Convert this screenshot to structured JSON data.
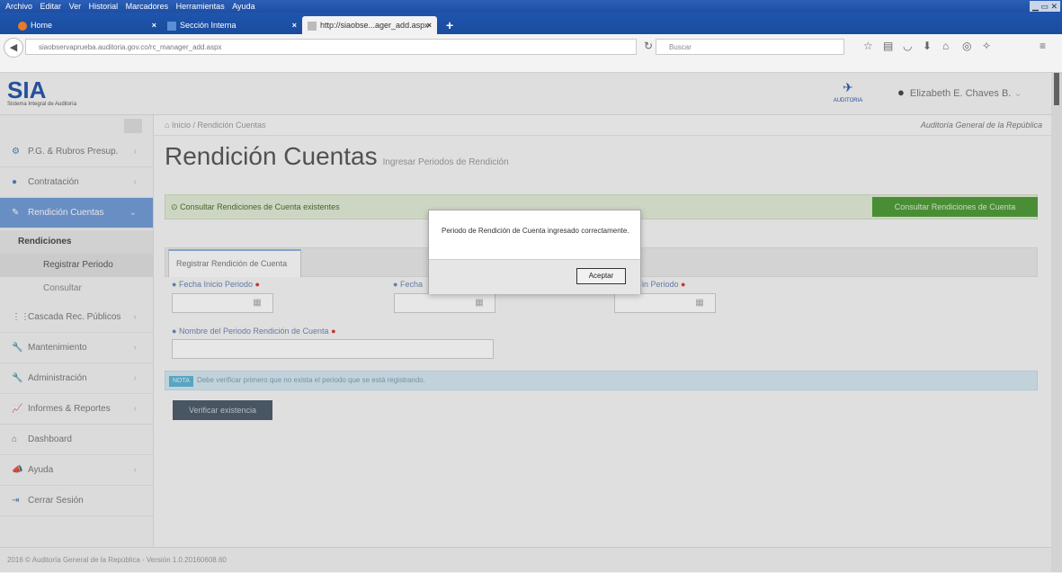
{
  "browser": {
    "menu": [
      "Archivo",
      "Editar",
      "Ver",
      "Historial",
      "Marcadores",
      "Herramientas",
      "Ayuda"
    ],
    "tabs": [
      {
        "label": "Home"
      },
      {
        "label": "Sección Interna"
      },
      {
        "label": "http://siaobse...ager_add.aspx"
      }
    ],
    "url": "siaobservaprueba.auditoria.gov.co/rc_manager_add.aspx",
    "search_placeholder": "Buscar"
  },
  "header": {
    "logo_text": "SIA",
    "logo_sub": "Sistema Integral de Auditoría",
    "auditoria_label": "AUDITORIA",
    "user_name": "Elizabeth E. Chaves B."
  },
  "sidebar": {
    "items": [
      {
        "label": "P.G. & Rubros Presup.",
        "icon": "sliders-icon"
      },
      {
        "label": "Contratación",
        "icon": "circle-icon"
      },
      {
        "label": "Rendición Cuentas",
        "icon": "edit-icon"
      },
      {
        "label": "Cascada Rec. Públicos",
        "icon": "grid-icon"
      },
      {
        "label": "Mantenimiento",
        "icon": "wrench-icon"
      },
      {
        "label": "Administración",
        "icon": "wrench-icon"
      },
      {
        "label": "Informes & Reportes",
        "icon": "chart-icon"
      },
      {
        "label": "Dashboard",
        "icon": "home-icon"
      },
      {
        "label": "Ayuda",
        "icon": "bullhorn-icon"
      },
      {
        "label": "Cerrar Sesión",
        "icon": "logout-icon"
      }
    ],
    "sub_header": "Rendiciones",
    "sub_items": [
      "Registrar Periodo",
      "Consultar"
    ]
  },
  "breadcrumb": {
    "home": "Inicio",
    "current": "Rendición Cuentas",
    "org": "Auditoría General de la República"
  },
  "page": {
    "title": "Rendición Cuentas",
    "subtitle": "Ingresar Periodos de Rendición",
    "alert": "Consultar Rendiciones de Cuenta existentes",
    "consult_button": "Consultar Rendiciones de Cuenta"
  },
  "form": {
    "tab": "Registrar Rendición de Cuenta",
    "label_inicio": "Fecha Inicio Periodo",
    "label_mid": "Fecha",
    "label_fin": "a Fin Periodo",
    "label_nombre": "Nombre del Periodo Rendición de Cuenta",
    "note_badge": "NOTA",
    "note_text": "Debe verificar primero que no exista el periodo que se está registrando.",
    "verify_button": "Verificar existencia"
  },
  "modal": {
    "message": "Periodo de Rendición de Cuenta ingresado correctamente.",
    "ok_button": "Aceptar"
  },
  "footer": {
    "text": "2016 © Auditoría General de la República - Versión 1.0.20160608.60"
  }
}
